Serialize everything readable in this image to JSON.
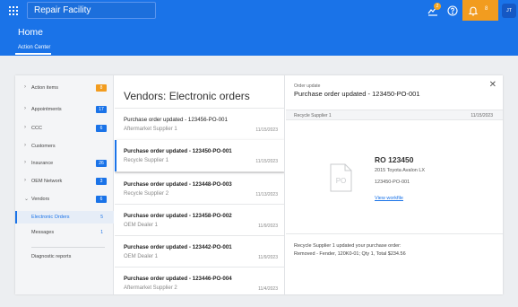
{
  "header": {
    "facility": "Repair Facility",
    "badge_count": "2",
    "notif_count": "8",
    "avatar": "JT",
    "colors": {
      "primary": "#1a73e8",
      "accent": "#f29c1f"
    }
  },
  "page": {
    "title": "Home",
    "tab": "Action Center"
  },
  "sidebar": {
    "items": [
      {
        "label": "Action items",
        "count": "8",
        "chev": "›"
      },
      {
        "label": "Appointments",
        "count": "17",
        "chev": "›"
      },
      {
        "label": "CCC",
        "count": "6",
        "chev": "›"
      },
      {
        "label": "Customers",
        "count": "",
        "chev": "›"
      },
      {
        "label": "Insurance",
        "count": "26",
        "chev": "›"
      },
      {
        "label": "OEM Network",
        "count": "3",
        "chev": "›"
      },
      {
        "label": "Vendors",
        "count": "6",
        "chev": "⌄"
      }
    ],
    "subitems": [
      {
        "label": "Electronic Orders",
        "count": "5"
      },
      {
        "label": "Messages",
        "count": "1"
      }
    ],
    "diagnostic": "Diagnostic reports"
  },
  "list": {
    "title": "Vendors: Electronic orders",
    "orders": [
      {
        "title": "Purchase order updated - 123456-PO-001",
        "vendor": "Aftermarket Supplier 1",
        "date": "11/15/2023"
      },
      {
        "title": "Purchase order updated - 123450-PO-001",
        "vendor": "Recycle Supplier 1",
        "date": "11/15/2023"
      },
      {
        "title": "Purchase order updated - 123448-PO-003",
        "vendor": "Recycle Supplier 2",
        "date": "11/13/2023"
      },
      {
        "title": "Purchase order updated - 123458-PO-002",
        "vendor": "OEM Dealer 1",
        "date": "11/9/2023"
      },
      {
        "title": "Purchase order updated - 123442-PO-001",
        "vendor": "OEM Dealer 1",
        "date": "11/9/2023"
      },
      {
        "title": "Purchase order updated - 123446-PO-004",
        "vendor": "Aftermarket Supplier 2",
        "date": "11/4/2023"
      }
    ]
  },
  "detail": {
    "overline": "Order update",
    "title": "Purchase order updated - 123450-PO-001",
    "vendor": "Recycle Supplier 1",
    "date": "11/15/2023",
    "icon_text": "PO",
    "ro": "RO 123450",
    "vehicle": "2015 Toyota Avalon LX",
    "po": "123450-PO-001",
    "workfile": "View workfile",
    "message_line1": "Recycle Supplier 1 updated your purchase order:",
    "message_line2": "Removed - Fender, 120K0-01; Qty 1, Total $234.56"
  }
}
